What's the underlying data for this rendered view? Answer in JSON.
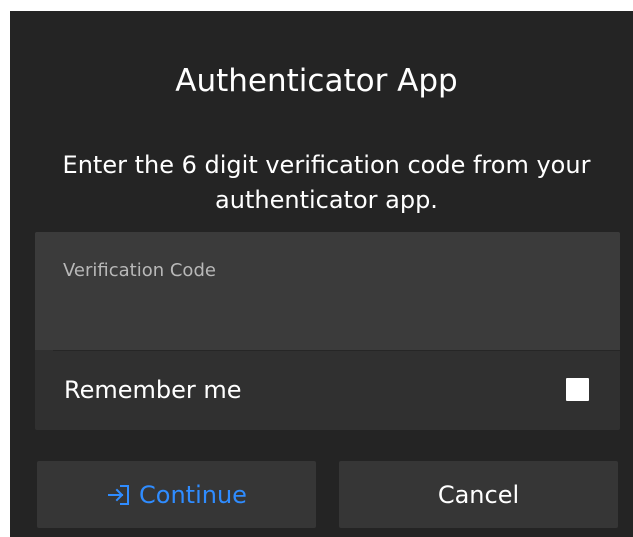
{
  "dialog": {
    "title": "Authenticator App",
    "description": "Enter the 6 digit verification code from your authenticator app."
  },
  "verification": {
    "label": "Verification Code",
    "value": "",
    "placeholder": ""
  },
  "remember": {
    "label": "Remember me",
    "checked": false
  },
  "actions": {
    "continue_label": "Continue",
    "continue_icon": "sign-in-icon",
    "cancel_label": "Cancel"
  },
  "colors": {
    "dialog_background": "#242424",
    "card_background": "#303030",
    "input_background": "#3b3b3b",
    "accent": "#2f8cff",
    "text": "#ffffff",
    "muted_text": "#b8b8b8"
  }
}
